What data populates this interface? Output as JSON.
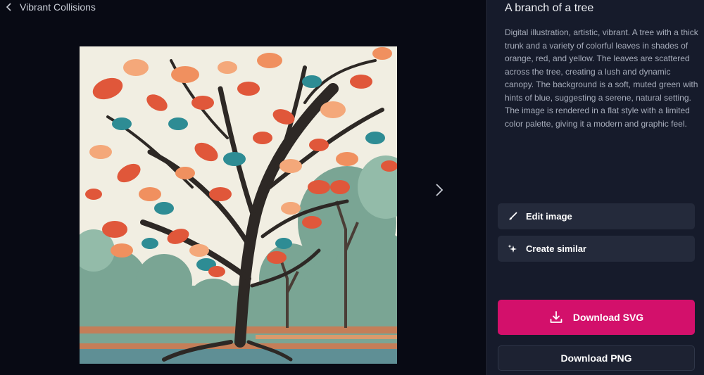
{
  "header": {
    "back_label": "Vibrant Collisions"
  },
  "image": {
    "title": "A branch of a tree",
    "description": "Digital illustration, artistic, vibrant. A tree with a thick trunk and a variety of colorful leaves in shades of orange, red, and yellow. The leaves are scattered across the tree, creating a lush and dynamic canopy. The background is a soft, muted green with hints of blue, suggesting a serene, natural setting. The image is rendered in a flat style with a limited color palette, giving it a modern and graphic feel."
  },
  "actions": {
    "edit_label": "Edit image",
    "similar_label": "Create similar",
    "download_svg_label": "Download SVG",
    "download_png_label": "Download PNG"
  },
  "icons": {
    "back": "chevron-left-icon",
    "next": "chevron-right-icon",
    "edit": "brush-icon",
    "similar": "sparkles-icon",
    "download": "download-icon"
  },
  "colors": {
    "page_bg": "#080a14",
    "panel_bg": "#161b2b",
    "button_bg": "#242a3b",
    "primary_accent": "#d3106b"
  }
}
